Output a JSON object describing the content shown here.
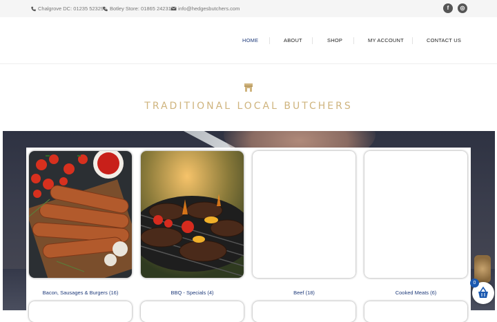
{
  "topbar": {
    "contacts": [
      {
        "icon": "phone-icon",
        "text": "Chalgrove DC: 01235 523295"
      },
      {
        "icon": "phone-icon",
        "text": "Botley Store: 01865 242318"
      },
      {
        "icon": "envelope-icon",
        "text": "info@hedgesbutchers.com"
      }
    ],
    "social": [
      {
        "icon": "facebook-icon",
        "glyph": "f"
      },
      {
        "icon": "instagram-icon",
        "glyph": "◎"
      }
    ]
  },
  "nav": {
    "items": [
      "HOME",
      "ABOUT",
      "SHOP",
      "MY ACCOUNT",
      "CONTACT US"
    ],
    "active": "HOME"
  },
  "tagline": "TRADITIONAL LOCAL BUTCHERS",
  "categories": [
    {
      "name": "Bacon, Sausages & Burgers",
      "count": "(16)"
    },
    {
      "name": "BBQ - Specials",
      "count": "(4)"
    },
    {
      "name": "Beef",
      "count": "(18)"
    },
    {
      "name": "Cooked Meats",
      "count": "(6)"
    }
  ],
  "cart": {
    "count": "0"
  },
  "colors": {
    "accent": "#1e3a7a",
    "tagline": "#cfb47e",
    "cart_badge": "#1a58b0"
  }
}
